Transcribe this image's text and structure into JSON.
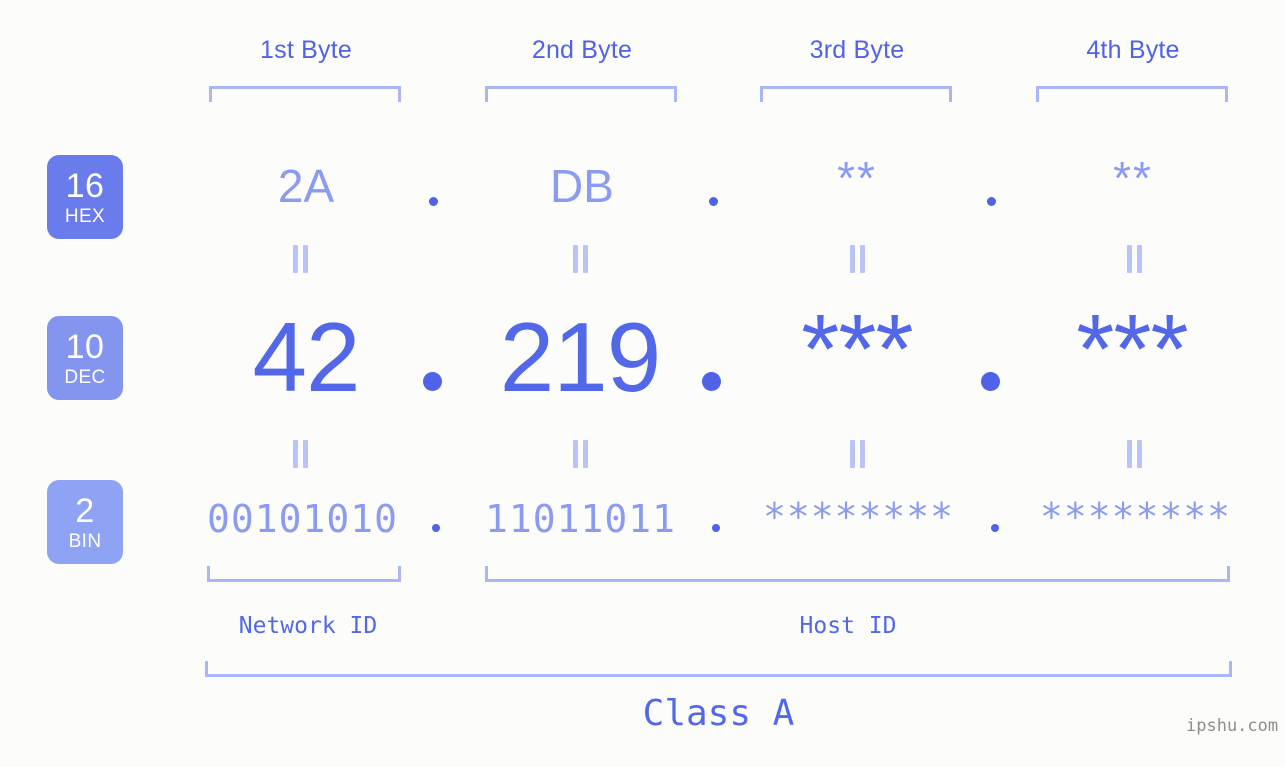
{
  "background_color": "#fcfdfa",
  "accent_color": "#4f62e8",
  "accent_light_color": "#8b9bf2",
  "bracket_color": "#aab6f5",
  "byte_headers": [
    {
      "label": "1st Byte"
    },
    {
      "label": "2nd Byte"
    },
    {
      "label": "3rd Byte"
    },
    {
      "label": "4th Byte"
    }
  ],
  "rows": [
    {
      "base_number": "16",
      "base_name": "HEX",
      "badge_color": "#6a7cec",
      "values": [
        "2A",
        "DB",
        "**",
        "**"
      ],
      "separators": [
        ".",
        ".",
        "."
      ]
    },
    {
      "base_number": "10",
      "base_name": "DEC",
      "badge_color": "#8495f0",
      "values": [
        "42",
        "219",
        "***",
        "***"
      ],
      "separators": [
        ".",
        ".",
        "."
      ]
    },
    {
      "base_number": "2",
      "base_name": "BIN",
      "badge_color": "#8fa3f4",
      "values": [
        "00101010",
        "11011011",
        "********",
        "********"
      ],
      "separators": [
        ".",
        ".",
        "."
      ]
    }
  ],
  "equality_symbol": "=",
  "segments": {
    "network_id": "Network ID",
    "host_id": "Host ID"
  },
  "class_label": "Class A",
  "watermark": "ipshu.com"
}
